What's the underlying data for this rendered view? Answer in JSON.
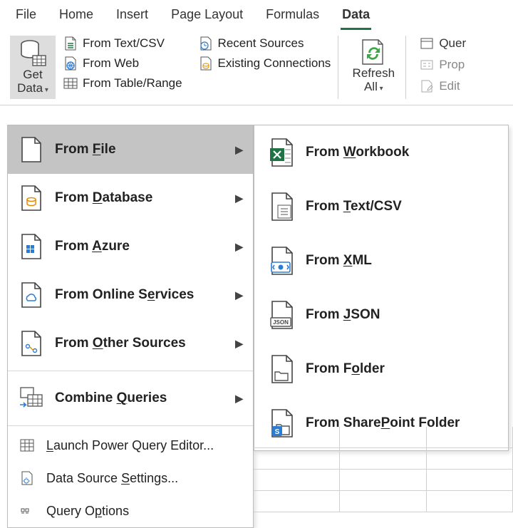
{
  "tabs": {
    "file": "File",
    "home": "Home",
    "insert": "Insert",
    "pagelayout": "Page Layout",
    "formulas": "Formulas",
    "data": "Data"
  },
  "ribbon": {
    "get_data": "Get\nData",
    "from_textcsv": "From Text/CSV",
    "from_web": "From Web",
    "from_table": "From Table/Range",
    "recent": "Recent Sources",
    "existing": "Existing Connections",
    "refresh": "Refresh\nAll",
    "queries": "Quer",
    "properties": "Prop",
    "edit": "Edit"
  },
  "menu": {
    "from_file": "From File",
    "from_database": "From Database",
    "from_azure": "From Azure",
    "from_online": "From Online Services",
    "from_other": "From Other Sources",
    "combine": "Combine Queries",
    "launch": "Launch Power Query Editor...",
    "settings": "Data Source Settings...",
    "options": "Query Options"
  },
  "submenu": {
    "workbook": "From Workbook",
    "textcsv": "From Text/CSV",
    "xml": "From XML",
    "json": "From JSON",
    "folder": "From Folder",
    "sharepoint": "From SharePoint Folder"
  }
}
